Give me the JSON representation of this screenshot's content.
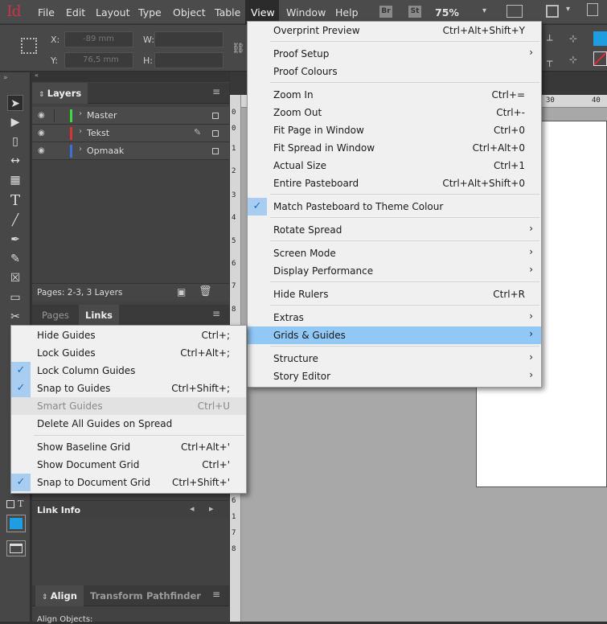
{
  "menubar": {
    "logo": "Id",
    "items": [
      "File",
      "Edit",
      "Layout",
      "Type",
      "Object",
      "Table",
      "View",
      "Window",
      "Help"
    ],
    "br": "Br",
    "st": "St",
    "zoom": "75%"
  },
  "control": {
    "x_label": "X:",
    "y_label": "Y:",
    "w_label": "W:",
    "h_label": "H:",
    "x_value": "-89 mm",
    "y_value": "76,5 mm"
  },
  "layers": {
    "tab_label": "Layers",
    "rows": [
      {
        "name": "Master",
        "color": "#3ddc3d"
      },
      {
        "name": "Tekst",
        "color": "#e03030"
      },
      {
        "name": "Opmaak",
        "color": "#3c6fd8"
      }
    ],
    "footer": "Pages: 2-3, 3 Layers"
  },
  "pages_tab": "Pages",
  "links_tab": "Links",
  "link_info": "Link Info",
  "align": {
    "tabs": [
      "Align",
      "Transform",
      "Pathfinder"
    ],
    "sub": "Align Objects:"
  },
  "ruler": {
    "top_marks": [
      "30",
      "40"
    ],
    "left_marks": [
      "0",
      "0",
      "1",
      "2",
      "3",
      "4",
      "5",
      "6",
      "7",
      "8"
    ],
    "left_marks_lower": [
      "6",
      "1",
      "7",
      "8"
    ]
  },
  "view_menu": {
    "items": [
      {
        "label": "Overprint Preview",
        "shortcut": "Ctrl+Alt+Shift+Y"
      },
      {
        "label": "Proof Setup",
        "submenu": true
      },
      {
        "label": "Proof Colours"
      },
      {
        "label": "Zoom In",
        "shortcut": "Ctrl+="
      },
      {
        "label": "Zoom Out",
        "shortcut": "Ctrl+-"
      },
      {
        "label": "Fit Page in Window",
        "shortcut": "Ctrl+0"
      },
      {
        "label": "Fit Spread in Window",
        "shortcut": "Ctrl+Alt+0"
      },
      {
        "label": "Actual Size",
        "shortcut": "Ctrl+1"
      },
      {
        "label": "Entire Pasteboard",
        "shortcut": "Ctrl+Alt+Shift+0"
      },
      {
        "label": "Match Pasteboard to Theme Colour",
        "checked": true
      },
      {
        "label": "Rotate Spread",
        "submenu": true
      },
      {
        "label": "Screen Mode",
        "submenu": true
      },
      {
        "label": "Display Performance",
        "submenu": true
      },
      {
        "label": "Hide Rulers",
        "shortcut": "Ctrl+R"
      },
      {
        "label": "Extras",
        "submenu": true
      },
      {
        "label": "Grids & Guides",
        "submenu": true
      },
      {
        "label": "Structure",
        "submenu": true
      },
      {
        "label": "Story Editor",
        "submenu": true
      }
    ]
  },
  "grids_menu": {
    "items": [
      {
        "label": "Hide Guides",
        "shortcut": "Ctrl+;"
      },
      {
        "label": "Lock Guides",
        "shortcut": "Ctrl+Alt+;"
      },
      {
        "label": "Lock Column Guides",
        "checked": true
      },
      {
        "label": "Snap to Guides",
        "shortcut": "Ctrl+Shift+;",
        "checked": true
      },
      {
        "label": "Smart Guides",
        "shortcut": "Ctrl+U",
        "disabled": true
      },
      {
        "label": "Delete All Guides on Spread"
      },
      {
        "label": "Show Baseline Grid",
        "shortcut": "Ctrl+Alt+'"
      },
      {
        "label": "Show Document Grid",
        "shortcut": "Ctrl+'"
      },
      {
        "label": "Snap to Document Grid",
        "shortcut": "Ctrl+Shift+'",
        "checked": true
      }
    ]
  },
  "colors": {
    "accent": "#1e88e5",
    "highlight": "#91c8f6"
  }
}
